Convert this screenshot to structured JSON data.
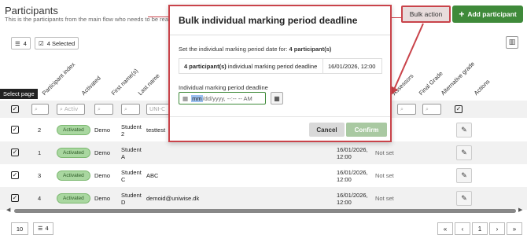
{
  "header": {
    "title": "Participants",
    "subtitle": "This is the participants from the main flow who needs to be reassessed",
    "bulk_action": "Bulk action",
    "add_participant": "Add participant"
  },
  "toolbar": {
    "list_count": "4",
    "selected": "4 Selected"
  },
  "columns": [
    "Participant index",
    "Activated",
    "First name(s)",
    "Last name",
    "Assessors",
    "Final Grade",
    "Alternative grade",
    "Actions"
  ],
  "filters": {
    "activated_placeholder": "Activ",
    "email_placeholder": "UNI-C"
  },
  "tooltip": "Select page",
  "rows": [
    {
      "index": "2",
      "status": "Activated",
      "first": "Demo",
      "last": "Student 2",
      "email": "testtest",
      "deadline": "",
      "assessor": ""
    },
    {
      "index": "1",
      "status": "Activated",
      "first": "Demo",
      "last": "Student A",
      "email": "",
      "deadline": "16/01/2026, 12:00",
      "assessor": "Not set"
    },
    {
      "index": "3",
      "status": "Activated",
      "first": "Demo",
      "last": "Student C",
      "email": "ABC",
      "deadline": "16/01/2026, 12:00",
      "assessor": "Not set"
    },
    {
      "index": "4",
      "status": "Activated",
      "first": "Demo",
      "last": "Student D",
      "email": "demoid@uniwise.dk",
      "deadline": "16/01/2026, 12:00",
      "assessor": "Not set"
    }
  ],
  "footer": {
    "page_size": "10",
    "count": "4",
    "current_page": "1"
  },
  "modal": {
    "title": "Bulk individual marking period deadline",
    "desc_prefix": "Set the individual marking period date for:",
    "desc_bold": "4 participant(s)",
    "summary_bold": "4 participant(s)",
    "summary_rest": "individual marking period deadline",
    "summary_date": "16/01/2026, 12:00",
    "field_label": "Individual marking period deadline",
    "date_hl": "mm",
    "date_rest": "/dd/yyyy, --:-- -- AM",
    "cancel": "Cancel",
    "confirm": "Confirm"
  },
  "colors": {
    "accent": "#3f8a3a",
    "highlight": "#c9434a"
  }
}
